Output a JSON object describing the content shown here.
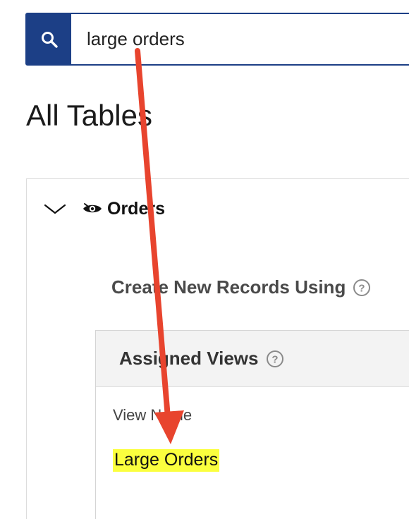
{
  "search": {
    "value": "large orders",
    "icon": "search-icon"
  },
  "page": {
    "title": "All Tables"
  },
  "table": {
    "name": "Orders",
    "expanded": true,
    "create_label": "Create New Records Using",
    "assigned_views": {
      "title": "Assigned Views",
      "column_header": "View Name",
      "rows": [
        {
          "name": "Large Orders",
          "highlighted": true
        }
      ]
    }
  },
  "colors": {
    "brand_blue": "#1c3f86",
    "highlight": "#fbff3e",
    "annotation_arrow": "#e8442e"
  }
}
